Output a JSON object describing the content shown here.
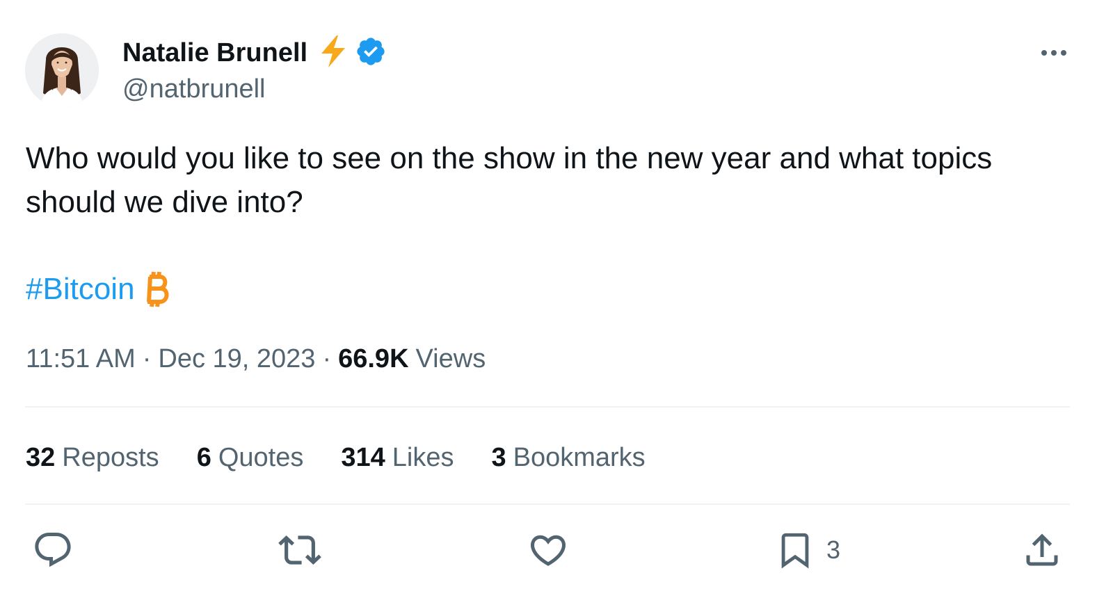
{
  "author": {
    "name": "Natalie Brunell",
    "handle": "@natbrunell",
    "verified": true
  },
  "tweet": {
    "text": "Who would you like to see on the show in the new year and what topics should we dive into?",
    "hashtag": "#Bitcoin",
    "time": "11:51 AM",
    "date": "Dec 19, 2023",
    "separator": "·",
    "views_count": "66.9K",
    "views_label": "Views"
  },
  "stats": [
    {
      "count": "32",
      "label": "Reposts"
    },
    {
      "count": "6",
      "label": "Quotes"
    },
    {
      "count": "314",
      "label": "Likes"
    },
    {
      "count": "3",
      "label": "Bookmarks"
    }
  ],
  "actions": {
    "bookmark_count": "3"
  },
  "icons": {
    "lightning": "lightning-bolt-icon",
    "verified": "verified-badge-icon",
    "more": "more-options-icon",
    "bitcoin": "bitcoin-icon",
    "reply": "reply-icon",
    "repost": "repost-icon",
    "like": "like-icon",
    "bookmark": "bookmark-icon",
    "share": "share-icon"
  },
  "colors": {
    "text_primary": "#0f1419",
    "text_secondary": "#536471",
    "link": "#1d9bf0",
    "verified": "#1d9bf0",
    "lightning": "#f7931a",
    "bitcoin": "#f7931a",
    "divider": "#eff3f4"
  }
}
